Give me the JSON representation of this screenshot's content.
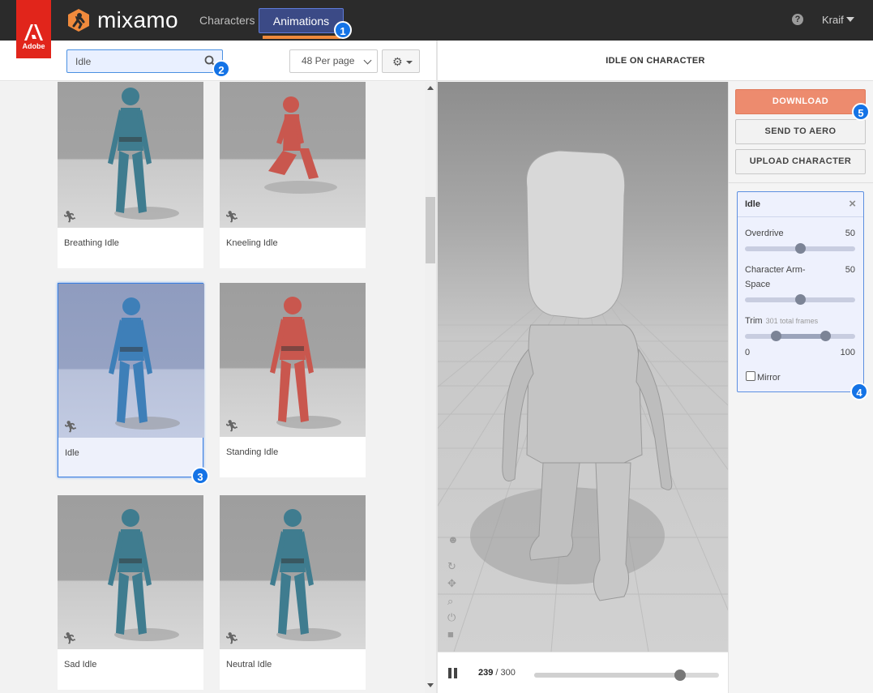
{
  "header": {
    "adobe_label": "Adobe",
    "brand": "mixamo",
    "tabs": [
      {
        "label": "Characters",
        "active": false
      },
      {
        "label": "Animations",
        "active": true
      }
    ],
    "help": "?",
    "user": "Kraif"
  },
  "toolbar": {
    "search_value": "Idle",
    "per_page": "48 Per page"
  },
  "animations": [
    {
      "name": "Breathing Idle",
      "color": "teal",
      "selected": false
    },
    {
      "name": "Kneeling Idle",
      "color": "red",
      "selected": false
    },
    {
      "name": "Idle",
      "color": "blue",
      "selected": true
    },
    {
      "name": "Standing Idle",
      "color": "red",
      "selected": false
    },
    {
      "name": "Sad Idle",
      "color": "teal",
      "selected": false
    },
    {
      "name": "Neutral Idle",
      "color": "teal",
      "selected": false
    }
  ],
  "viewport": {
    "title": "IDLE ON CHARACTER",
    "current_frame": "239",
    "total_frames": "/ 300",
    "progress": 0.79
  },
  "actions": {
    "download": "DOWNLOAD",
    "send_to_aero": "SEND TO AERO",
    "upload_character": "UPLOAD CHARACTER"
  },
  "settings": {
    "title": "Idle",
    "overdrive_label": "Overdrive",
    "overdrive_value": "50",
    "overdrive_level": 0.5,
    "arm_space_label_1": "Character Arm-",
    "arm_space_label_2": "Space",
    "arm_space_value": "50",
    "arm_space_level": 0.5,
    "trim_label": "Trim",
    "trim_sub": "301 total frames",
    "trim_start": "0",
    "trim_end": "100",
    "trim_start_level": 0.28,
    "trim_end_level": 0.73,
    "mirror_label": "Mirror"
  },
  "badges": [
    "1",
    "2",
    "3",
    "4",
    "5"
  ],
  "colors": {
    "topbar": "#2b2b2b",
    "adobe_red": "#e1251b",
    "accent_blue": "#1473e6",
    "download": "#ed8b6e",
    "tab_underline": "#f08a3c",
    "figure_teal": "#3f7c8f",
    "figure_red": "#c9574e",
    "figure_blue": "#3e7fb8"
  }
}
